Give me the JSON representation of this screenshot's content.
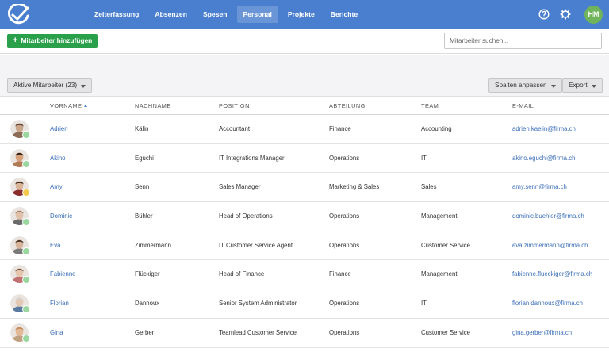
{
  "app": {
    "nav": [
      "Zeiterfassung",
      "Absenzen",
      "Spesen",
      "Personal",
      "Projekte",
      "Berichte"
    ],
    "active_nav": "Personal",
    "user_initials": "HM",
    "accent_color": "#4a7fd0"
  },
  "actions": {
    "add_label": "Mitarbeiter hinzufügen",
    "search_placeholder": "Mitarbeiter suchen..."
  },
  "filters": {
    "scope_label": "Aktive Mitarbeiter (23)",
    "columns_label": "Spalten anpassen",
    "export_label": "Export"
  },
  "table": {
    "headers": {
      "first_name": "VORNAME",
      "last_name": "NACHNAME",
      "position": "POSITION",
      "department": "ABTEILUNG",
      "team": "TEAM",
      "email": "E-MAIL"
    },
    "sort_column": "first_name",
    "rows": [
      {
        "first_name": "Adrien",
        "last_name": "Kälin",
        "position": "Accountant",
        "department": "Finance",
        "team": "Accounting",
        "email": "adrien.kaelin@firma.ch",
        "status": "green"
      },
      {
        "first_name": "Akino",
        "last_name": "Eguchi",
        "position": "IT Integrations Manager",
        "department": "Operations",
        "team": "IT",
        "email": "akino.eguchi@firma.ch",
        "status": "green"
      },
      {
        "first_name": "Amy",
        "last_name": "Senn",
        "position": "Sales Manager",
        "department": "Marketing & Sales",
        "team": "Sales",
        "email": "amy.senn@firma.ch",
        "status": "yellow"
      },
      {
        "first_name": "Dominic",
        "last_name": "Bühler",
        "position": "Head of Operations",
        "department": "Operations",
        "team": "Management",
        "email": "dominic.buehler@firma.ch",
        "status": "green"
      },
      {
        "first_name": "Eva",
        "last_name": "Zimmermann",
        "position": "IT Customer Service Agent",
        "department": "Operations",
        "team": "Customer Service",
        "email": "eva.zimmermann@firma.ch",
        "status": "green"
      },
      {
        "first_name": "Fabienne",
        "last_name": "Flückiger",
        "position": "Head of Finance",
        "department": "Finance",
        "team": "Management",
        "email": "fabienne.flueckiger@firma.ch",
        "status": "green"
      },
      {
        "first_name": "Florian",
        "last_name": "Dannoux",
        "position": "Senior System Administrator",
        "department": "Operations",
        "team": "IT",
        "email": "florian.dannoux@firma.ch",
        "status": "green"
      },
      {
        "first_name": "Gina",
        "last_name": "Gerber",
        "position": "Teamlead Customer Service",
        "department": "Operations",
        "team": "Customer Service",
        "email": "gina.gerber@firma.ch",
        "status": "green"
      }
    ]
  },
  "status_colors": {
    "green": "#9ad6a0",
    "yellow": "#f2c94c"
  }
}
